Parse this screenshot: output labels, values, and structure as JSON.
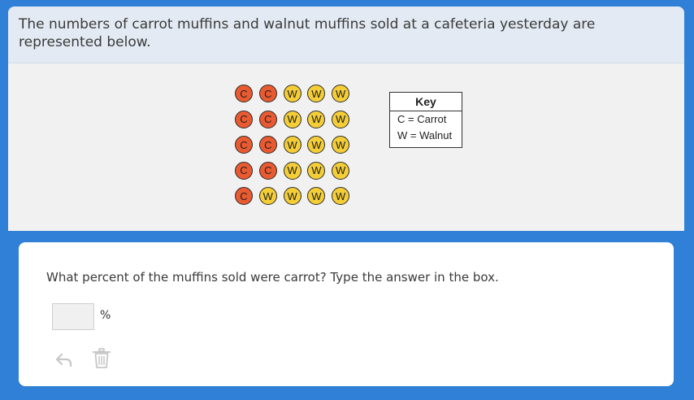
{
  "prompt": {
    "line1": "The numbers of carrot muffins and walnut muffins sold at a cafeteria yesterday are",
    "line2": "represented below."
  },
  "muffins": {
    "rows": [
      [
        "C",
        "C",
        "W",
        "W",
        "W"
      ],
      [
        "C",
        "C",
        "W",
        "W",
        "W"
      ],
      [
        "C",
        "C",
        "W",
        "W",
        "W"
      ],
      [
        "C",
        "C",
        "W",
        "W",
        "W"
      ],
      [
        "C",
        "W",
        "W",
        "W",
        "W"
      ]
    ],
    "colors": {
      "carrot": "#ea5a30",
      "walnut": "#f4cd37"
    }
  },
  "key": {
    "title": "Key",
    "carrot": "C = Carrot",
    "walnut": "W = Walnut"
  },
  "question": {
    "text": "What percent of the muffins sold were carrot? Type the answer in the box.",
    "answer_value": "",
    "unit": "%"
  },
  "icons": {
    "undo": "undo-icon",
    "delete": "trash-icon"
  }
}
